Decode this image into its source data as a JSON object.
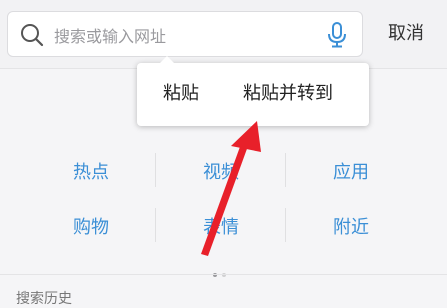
{
  "search": {
    "placeholder": "搜索或输入网址",
    "value": ""
  },
  "header": {
    "cancel_label": "取消"
  },
  "popup": {
    "paste_label": "粘贴",
    "paste_go_label": "粘贴并转到"
  },
  "grid": {
    "row1": [
      "热点",
      "视频",
      "应用"
    ],
    "row2": [
      "购物",
      "表情",
      "附近"
    ]
  },
  "pager": {
    "pages": 2,
    "active": 0
  },
  "history": {
    "label": "搜索历史"
  },
  "colors": {
    "accent": "#3b8fd6",
    "annotation_arrow": "#e8202a"
  },
  "icons": {
    "search": "search-icon",
    "mic": "microphone-icon"
  }
}
